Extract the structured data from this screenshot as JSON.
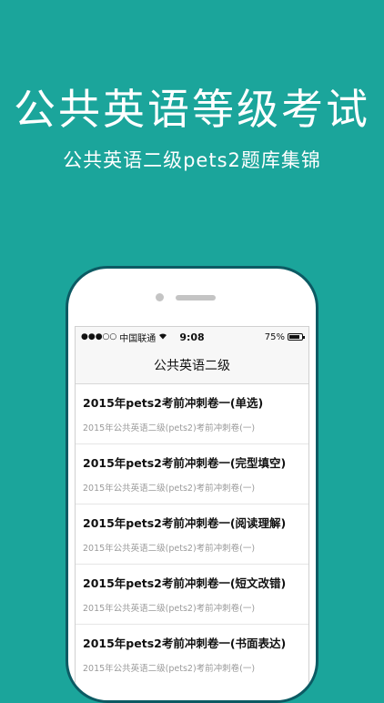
{
  "hero": {
    "title": "公共英语等级考试",
    "subtitle": "公共英语二级pets2题库集锦"
  },
  "status_bar": {
    "signal": "●●●○○",
    "carrier": "中国联通",
    "wifi_icon": "wifi-icon",
    "time": "9:08",
    "battery_percent": "75%",
    "battery_level": 0.75
  },
  "nav": {
    "title": "公共英语二级"
  },
  "list": [
    {
      "title": "2015年pets2考前冲刺卷一(单选)",
      "subtitle": "2015年公共英语二级(pets2)考前冲刺卷(一)"
    },
    {
      "title": "2015年pets2考前冲刺卷一(完型填空)",
      "subtitle": "2015年公共英语二级(pets2)考前冲刺卷(一)"
    },
    {
      "title": "2015年pets2考前冲刺卷一(阅读理解)",
      "subtitle": "2015年公共英语二级(pets2)考前冲刺卷(一)"
    },
    {
      "title": "2015年pets2考前冲刺卷一(短文改错)",
      "subtitle": "2015年公共英语二级(pets2)考前冲刺卷(一)"
    },
    {
      "title": "2015年pets2考前冲刺卷一(书面表达)",
      "subtitle": "2015年公共英语二级(pets2)考前冲刺卷(一)"
    }
  ],
  "colors": {
    "background": "#1ba59b",
    "phone_border": "#0c5a63"
  }
}
